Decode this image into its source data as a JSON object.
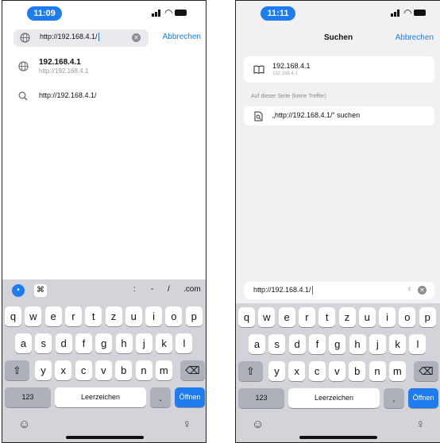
{
  "status": {
    "time_left": "11:09",
    "time_right": "11:11"
  },
  "left_screen": {
    "url_input": "http://192.168.4.1/",
    "cancel": "Abbrechen",
    "suggestions": [
      {
        "title": "192.168.4.1",
        "subtitle": "http://192.168.4.1"
      },
      {
        "title": "http://192.168.4.1/"
      }
    ]
  },
  "right_screen": {
    "title": "Suchen",
    "cancel": "Abbrechen",
    "bookmark": {
      "title": "192.168.4.1",
      "subtitle": "192.168.4.1"
    },
    "section_label": "Auf dieser Seite (keine Treffer)",
    "find_on_page": "„http://192.168.4.1/“ suchen",
    "url_input": "http://192.168.4.1/"
  },
  "keyboard": {
    "suggestion_keys": [
      ":",
      "-",
      "/",
      ".com"
    ],
    "row1": [
      "q",
      "w",
      "e",
      "r",
      "t",
      "z",
      "u",
      "i",
      "o",
      "p"
    ],
    "row2": [
      "a",
      "s",
      "d",
      "f",
      "g",
      "h",
      "j",
      "k",
      "l"
    ],
    "row3": [
      "y",
      "x",
      "c",
      "v",
      "b",
      "n",
      "m"
    ],
    "numbers": "123",
    "space": "Leerzeichen",
    "period": ".",
    "go": "Öffnen"
  },
  "colors": {
    "accent": "#1e7cf0",
    "keyboard_bg": "#d3d4d9"
  }
}
